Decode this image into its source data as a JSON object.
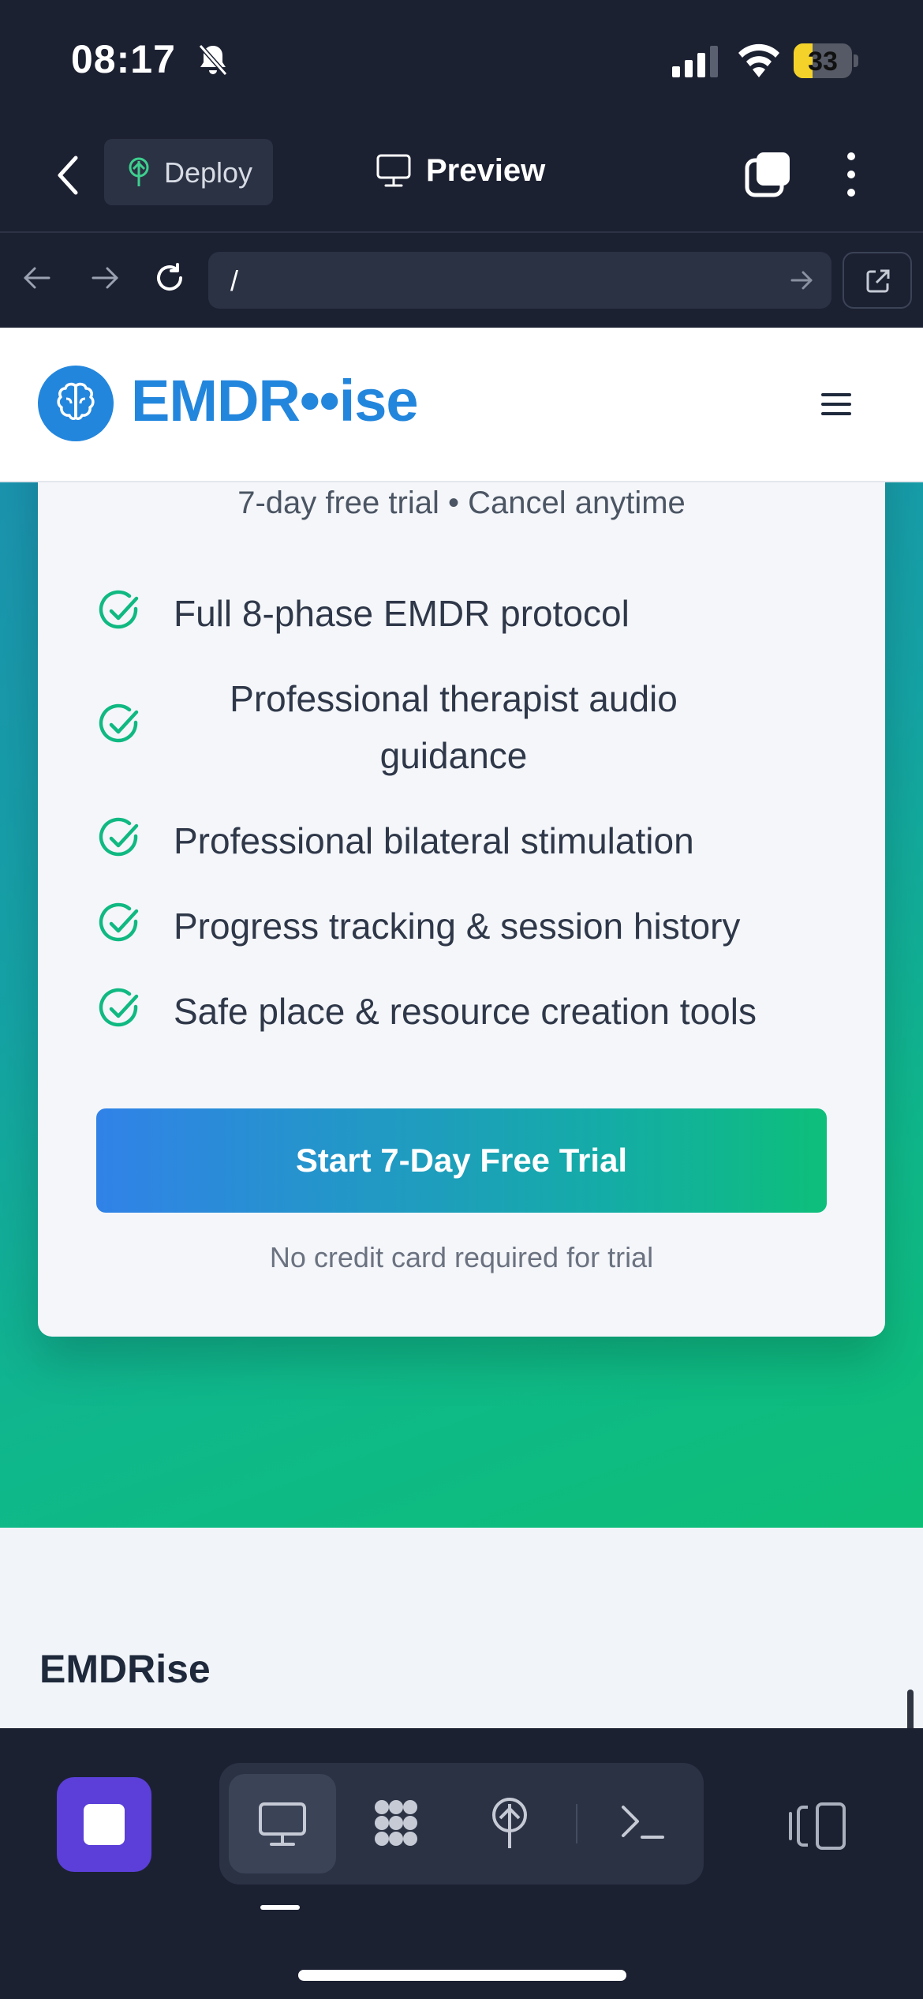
{
  "status_bar": {
    "time": "08:17",
    "battery": "33",
    "battery_level": 0.33
  },
  "toolbar": {
    "deploy_label": "Deploy",
    "preview_label": "Preview"
  },
  "address_bar": {
    "url": "/"
  },
  "site": {
    "logo_text": "EMDR••ise",
    "trial_subtitle": "7-day free trial • Cancel anytime",
    "features": [
      "Full 8-phase EMDR protocol",
      "Professional therapist audio guidance",
      "Professional bilateral stimulation",
      "Progress tracking & session history",
      "Safe place & resource creation tools"
    ],
    "cta_label": "Start 7-Day Free Trial",
    "cta_note": "No credit card required for trial",
    "footer_brand": "EMDRise"
  },
  "colors": {
    "accent": "#2386dd",
    "check_green": "#10b981",
    "toolbar_bg": "#1c2132",
    "stop_purple": "#5b3fd8"
  },
  "icons": [
    "back-icon",
    "deploy-icon",
    "monitor-icon",
    "tabs-icon",
    "more-icon",
    "arrow-left-icon",
    "arrow-right-icon",
    "reload-icon",
    "go-icon",
    "external-link-icon",
    "brain-icon",
    "menu-icon",
    "check-circle-icon",
    "stop-icon",
    "preview-tab-icon",
    "grid-icon",
    "deploy-tab-icon",
    "terminal-icon",
    "split-view-icon"
  ]
}
